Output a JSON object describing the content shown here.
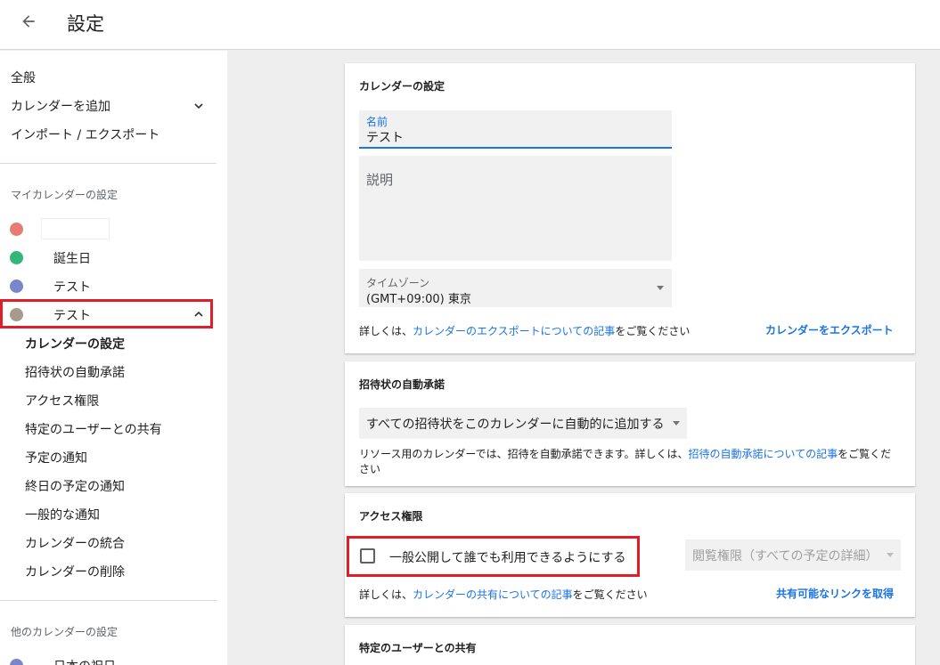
{
  "header": {
    "title": "設定"
  },
  "sidebar": {
    "top_items": [
      {
        "label": "全般"
      },
      {
        "label": "カレンダーを追加"
      },
      {
        "label": "インポート / エクスポート"
      }
    ],
    "my_calendars_heading": "マイカレンダーの設定",
    "calendars": [
      {
        "name": "",
        "color": "#e67c73"
      },
      {
        "name": "誕生日",
        "color": "#33b679"
      },
      {
        "name": "テスト",
        "color": "#7986cb"
      },
      {
        "name": "テスト",
        "color": "#a79b8e"
      }
    ],
    "sub_items": [
      {
        "label": "カレンダーの設定"
      },
      {
        "label": "招待状の自動承諾"
      },
      {
        "label": "アクセス権限"
      },
      {
        "label": "特定のユーザーとの共有"
      },
      {
        "label": "予定の通知"
      },
      {
        "label": "終日の予定の通知"
      },
      {
        "label": "一般的な通知"
      },
      {
        "label": "カレンダーの統合"
      },
      {
        "label": "カレンダーの削除"
      }
    ],
    "other_calendars_heading": "他のカレンダーの設定",
    "other_calendars": [
      {
        "name": "日本の祝日",
        "color": "#7986cb"
      }
    ]
  },
  "calendar_settings": {
    "title": "カレンダーの設定",
    "name_label": "名前",
    "name_value": "テスト",
    "description_label": "説明",
    "timezone_label": "タイムゾーン",
    "timezone_value": "(GMT+09:00) 東京",
    "info_prefix": "詳しくは、",
    "info_link": "カレンダーのエクスポートについての記事",
    "info_suffix": "をご覧ください",
    "export_button": "カレンダーをエクスポート"
  },
  "auto_accept": {
    "title": "招待状の自動承諾",
    "select_value": "すべての招待状をこのカレンダーに自動的に追加する",
    "info_prefix": "リソース用のカレンダーでは、招待を自動承諾できます。詳しくは、",
    "info_link": "招待の自動承諾についての記事",
    "info_suffix": "をご覧くだ",
    "info_tail": "さい"
  },
  "access": {
    "title": "アクセス権限",
    "public_checkbox_label": "一般公開して誰でも利用できるようにする",
    "permission_select": "閲覧権限（すべての予定の詳細）",
    "info_prefix": "詳しくは、",
    "info_link": "カレンダーの共有についての記事",
    "info_suffix": "をご覧ください",
    "share_link_button": "共有可能なリンクを取得"
  },
  "share_specific": {
    "title": "特定のユーザーとの共有"
  },
  "colors": {
    "accent": "#1a73e8",
    "highlight": "#e01e28"
  }
}
